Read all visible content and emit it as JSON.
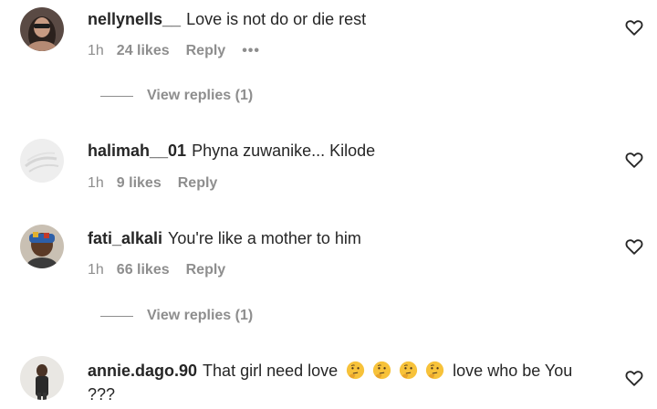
{
  "comments": [
    {
      "username": "nellynells__",
      "text": "Love is not do or die rest",
      "time": "1h",
      "likes": "24 likes",
      "reply": "Reply",
      "more": "•••",
      "view_replies": "View replies (1)",
      "avatar_icon": "user-avatar"
    },
    {
      "username": "halimah__01",
      "text": "Phyna zuwanike... Kilode",
      "time": "1h",
      "likes": "9 likes",
      "reply": "Reply",
      "avatar_icon": "user-avatar"
    },
    {
      "username": "fati_alkali",
      "text": "You're like a mother to him",
      "time": "1h",
      "likes": "66 likes",
      "reply": "Reply",
      "view_replies": "View replies (1)",
      "avatar_icon": "user-avatar"
    },
    {
      "username": "annie.dago.90",
      "text_before": "That girl need love",
      "emojis": [
        "thinking-face",
        "thinking-face",
        "thinking-face",
        "thinking-face"
      ],
      "text_after": "love who be You ???",
      "avatar_icon": "user-avatar"
    }
  ],
  "icons": {
    "like": "heart-outline-icon"
  },
  "colors": {
    "text": "#262626",
    "secondary": "#8e8e8e",
    "background": "#ffffff"
  }
}
